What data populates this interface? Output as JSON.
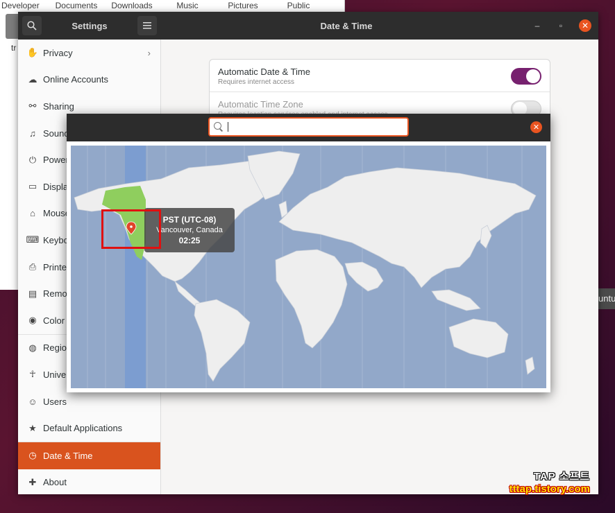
{
  "background_window": {
    "places": [
      "Developer",
      "Documents",
      "Downloads",
      "Music",
      "Pictures",
      "Public"
    ],
    "file_label": "tr",
    "dock_label": "untu"
  },
  "settings": {
    "title": "Settings",
    "page_title": "Date & Time",
    "sidebar": [
      {
        "label": "Privacy",
        "icon": "hand-icon",
        "chevron": true
      },
      {
        "label": "Online Accounts",
        "icon": "cloud-icon"
      },
      {
        "label": "Sharing",
        "icon": "share-icon"
      },
      {
        "label": "Sound",
        "icon": "music-note-icon"
      },
      {
        "label": "Power",
        "icon": "power-icon"
      },
      {
        "label": "Displays",
        "icon": "display-icon"
      },
      {
        "label": "Mouse & Touchpad",
        "icon": "mouse-icon"
      },
      {
        "label": "Keyboard Shortcuts",
        "icon": "keyboard-icon"
      },
      {
        "label": "Printers",
        "icon": "printer-icon"
      },
      {
        "label": "Removable Media",
        "icon": "removable-media-icon"
      },
      {
        "label": "Color",
        "icon": "color-icon"
      },
      {
        "label": "Region & Language",
        "icon": "globe-icon"
      },
      {
        "label": "Universal Access",
        "icon": "accessibility-icon"
      },
      {
        "label": "Users",
        "icon": "users-icon"
      },
      {
        "label": "Default Applications",
        "icon": "star-icon"
      },
      {
        "label": "Date & Time",
        "icon": "clock-icon",
        "active": true
      },
      {
        "label": "About",
        "icon": "plus-icon"
      }
    ],
    "rows": [
      {
        "title": "Automatic Date & Time",
        "subtitle": "Requires internet access",
        "on": true
      },
      {
        "title": "Automatic Time Zone",
        "subtitle": "Requires location services enabled and internet access",
        "on": false
      }
    ]
  },
  "timezone_dialog": {
    "search_value": "",
    "tooltip": {
      "zone": "PST (UTC-08)",
      "city": "Vancouver, Canada",
      "time": "02:25"
    }
  },
  "watermark": {
    "line1": "TAP 소프트",
    "line2": "tttap.tistory.com"
  },
  "colors": {
    "accent": "#e95420",
    "active_sidebar": "#d9531e",
    "toggle_on": "#77216f",
    "ocean": "#92a8c9",
    "land": "#eeeeee",
    "selected_zone": "#7c9dd0",
    "selected_region": "#8fce5e"
  }
}
